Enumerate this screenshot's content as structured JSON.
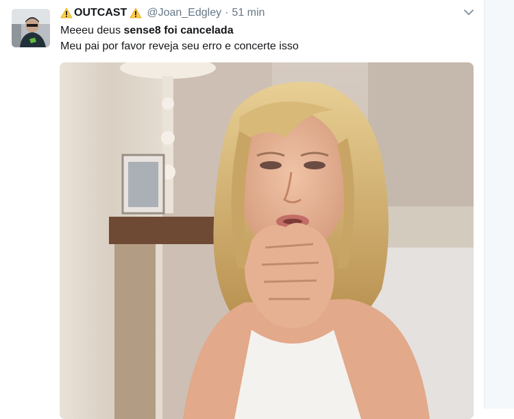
{
  "tweet": {
    "display_name": "OUTCAST",
    "handle": "@Joan_Edgley",
    "separator": "·",
    "time": "51 min",
    "text_line1_prefix": "Meeeu deus ",
    "text_line1_bold": "sense8 foi cancelada",
    "text_line2": "Meu pai por favor reveja seu erro e concerte isso",
    "icons": {
      "name_prefix": "warning-icon",
      "name_suffix": "warning-icon",
      "menu": "chevron-down-icon"
    },
    "media": "image"
  },
  "colors": {
    "text": "#14171a",
    "secondary": "#657786",
    "warning": "#ffcc4d"
  }
}
